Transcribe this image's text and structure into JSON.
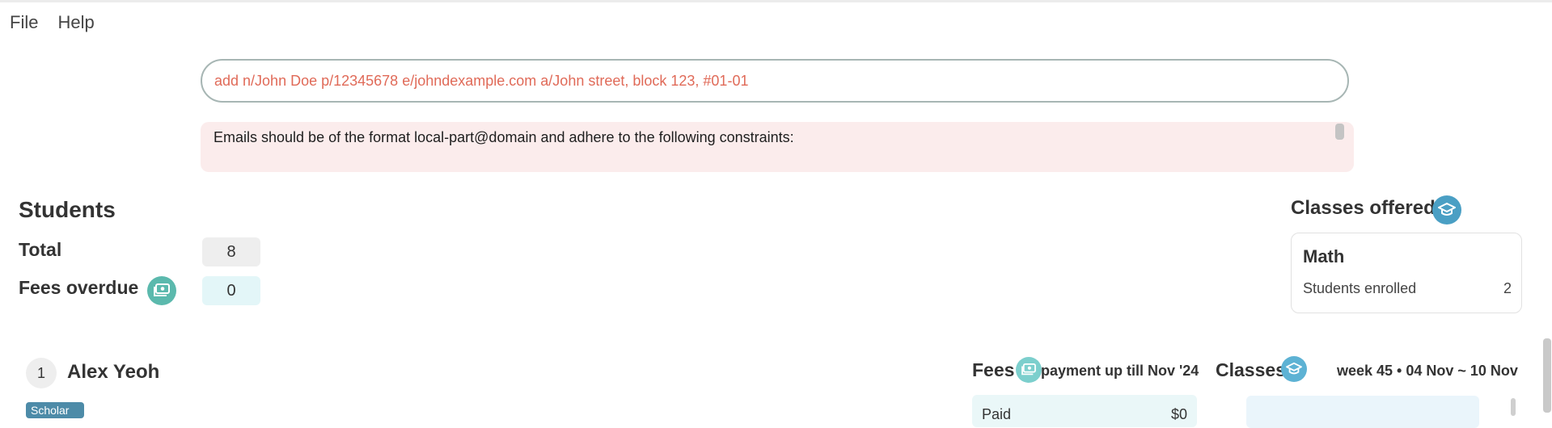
{
  "menu": {
    "items": [
      {
        "label": "File"
      },
      {
        "label": "Help"
      }
    ]
  },
  "command": {
    "value": "add n/John Doe p/12345678 e/johndexample.com a/John street, block 123, #01-01"
  },
  "result": {
    "message": "Emails should be of the format local-part@domain and adhere to the following constraints:"
  },
  "students": {
    "title": "Students",
    "total_label": "Total",
    "total_value": "8",
    "overdue_label": "Fees overdue",
    "overdue_value": "0"
  },
  "classes_offered": {
    "title": "Classes offered",
    "items": [
      {
        "name": "Math",
        "enrolled_label": "Students enrolled",
        "enrolled_count": "2"
      }
    ]
  },
  "student_list": [
    {
      "index": "1",
      "name": "Alex Yeoh",
      "tag": "Scholar",
      "fees_heading": "Fees",
      "payment_text": "payment up till Nov '24",
      "classes_heading": "Classes",
      "week_text": "week 45 • 04 Nov ~ 10 Nov",
      "fees_card_label": "Paid",
      "fees_card_value": "$0"
    }
  ],
  "icons": {
    "fees": "money-icon",
    "classes": "graduation-cap-icon"
  },
  "colors": {
    "error_text": "#e06a58",
    "error_bg": "#fbecec",
    "teal": "#5bb9ad",
    "blue": "#4a9fc4",
    "tag_bg": "#4d8ba8"
  }
}
